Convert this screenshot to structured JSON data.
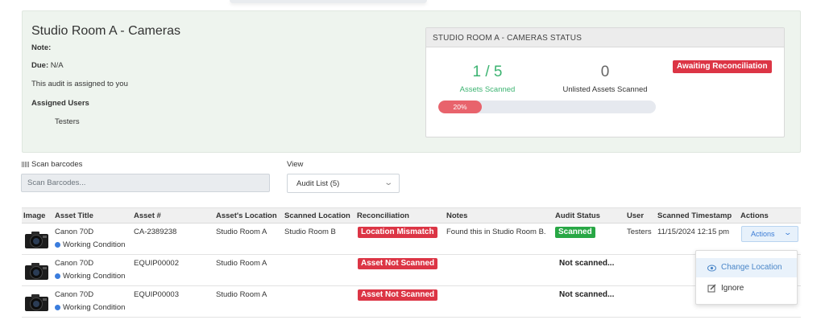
{
  "audit": {
    "title": "Studio Room A - Cameras",
    "note_label": "Note:",
    "due_label": "Due:",
    "due_value": "N/A",
    "assignment_text": "This audit is assigned to you",
    "assigned_users_label": "Assigned Users",
    "assigned_users": [
      "Testers"
    ]
  },
  "status_card": {
    "header": "STUDIO ROOM A - CAMERAS STATUS",
    "scanned_count": "1 / 5",
    "scanned_label": "Assets Scanned",
    "unlisted_count": "0",
    "unlisted_label": "Unlisted Assets Scanned",
    "status_badge": "Awaiting Reconciliation",
    "progress_percent": 20,
    "progress_label": "20%",
    "colors": {
      "progress": "#e8636c",
      "scanned": "#3cb371",
      "badge": "#dc3545"
    }
  },
  "scan": {
    "label": "Scan barcodes",
    "placeholder": "Scan Barcodes...",
    "icon": "barcode-icon"
  },
  "view": {
    "label": "View",
    "selected": "Audit List (5)"
  },
  "table": {
    "headers": [
      "Image",
      "Asset Title",
      "Asset #",
      "Asset's Location",
      "Scanned Location",
      "Reconciliation",
      "Notes",
      "Audit Status",
      "User",
      "Scanned Timestamp",
      "Actions"
    ],
    "rows": [
      {
        "title": "Canon 70D",
        "condition": "Working Condition",
        "asset_no": "CA-2389238",
        "location": "Studio Room A",
        "scanned_location": "Studio Room B",
        "reconciliation": "Location Mismatch",
        "notes": "Found this in Studio Room B.",
        "audit_status": "Scanned",
        "user": "Testers",
        "timestamp": "11/15/2024 12:15 pm",
        "actions": "Actions"
      },
      {
        "title": "Canon 70D",
        "condition": "Working Condition",
        "asset_no": "EQUIP00002",
        "location": "Studio Room A",
        "scanned_location": "",
        "reconciliation": "Asset Not Scanned",
        "notes": "",
        "audit_status": "Not scanned...",
        "user": "",
        "timestamp": ""
      },
      {
        "title": "Canon 70D",
        "condition": "Working Condition",
        "asset_no": "EQUIP00003",
        "location": "Studio Room A",
        "scanned_location": "",
        "reconciliation": "Asset Not Scanned",
        "notes": "",
        "audit_status": "Not scanned...",
        "user": "",
        "timestamp": ""
      }
    ]
  },
  "actions_menu": {
    "items": [
      {
        "label": "Change Location",
        "icon": "eye-icon"
      },
      {
        "label": "Ignore",
        "icon": "edit-icon"
      }
    ]
  }
}
